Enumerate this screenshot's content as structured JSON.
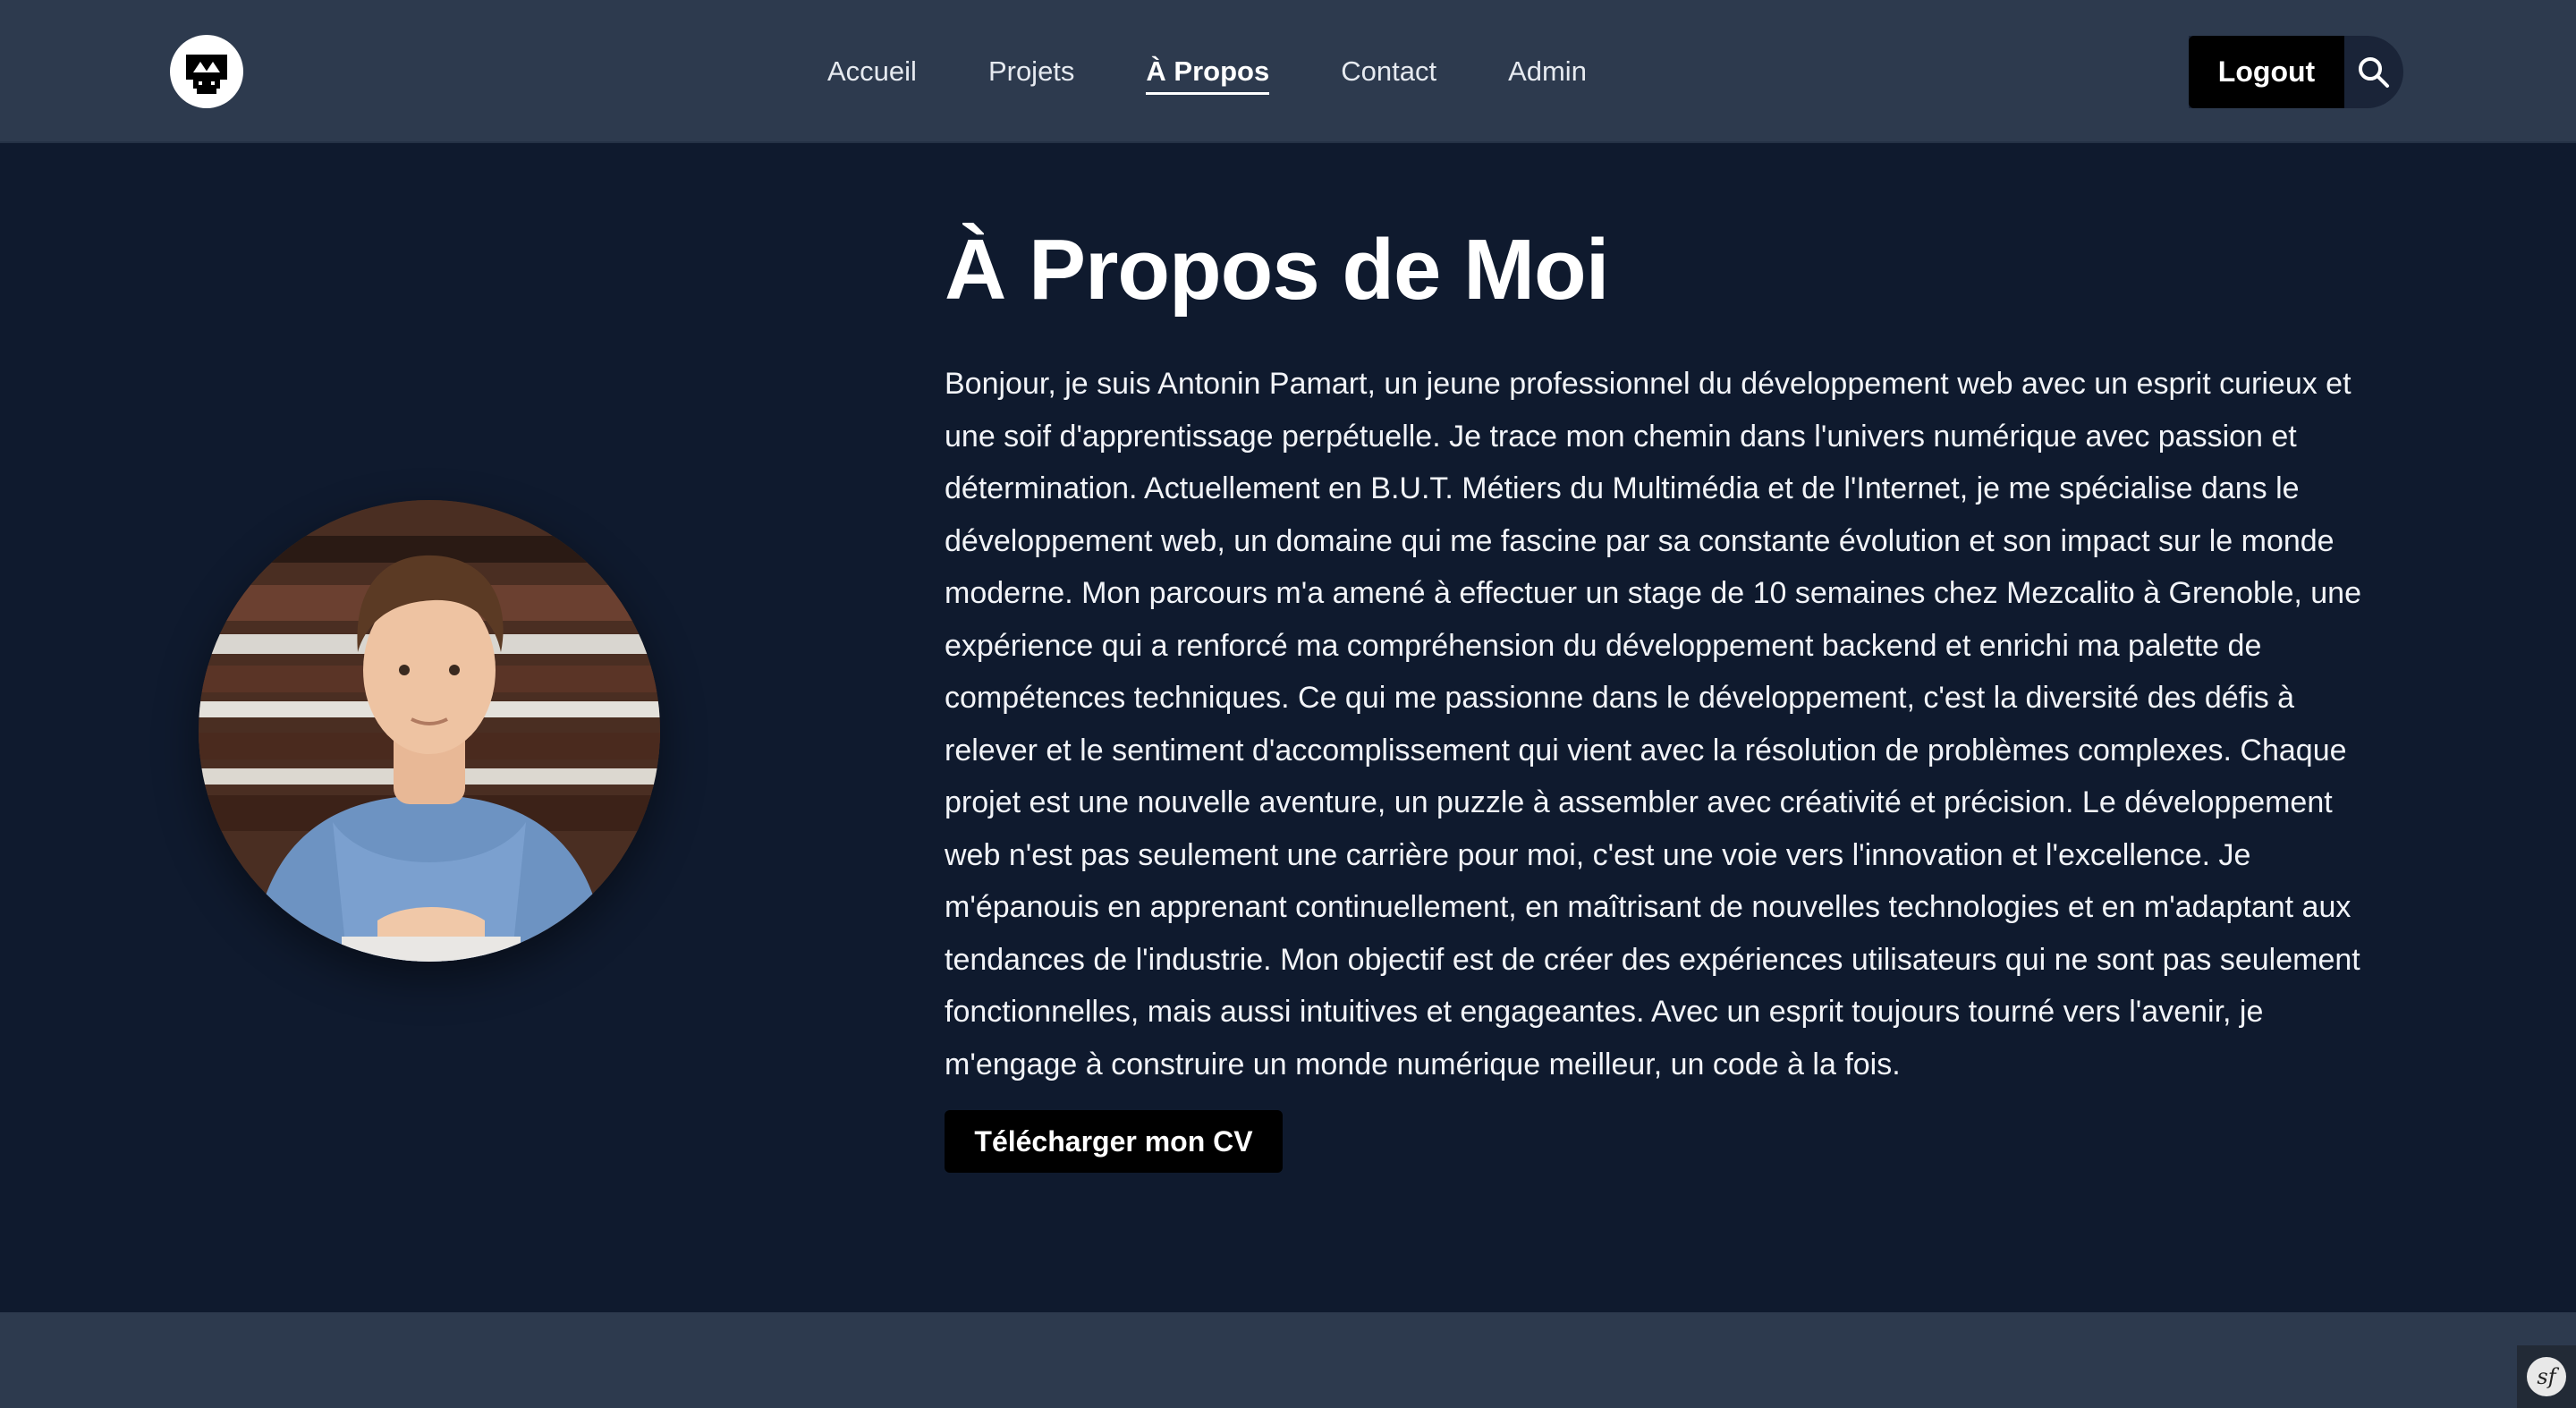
{
  "header": {
    "logo_icon": "pixel-face-logo-icon",
    "nav": [
      {
        "label": "Accueil",
        "active": false
      },
      {
        "label": "Projets",
        "active": false
      },
      {
        "label": "À Propos",
        "active": true
      },
      {
        "label": "Contact",
        "active": false
      },
      {
        "label": "Admin",
        "active": false
      }
    ],
    "logout_label": "Logout",
    "search_icon": "search-icon"
  },
  "main": {
    "title": "À Propos de Moi",
    "bio": "Bonjour, je suis Antonin Pamart, un jeune professionnel du développement web avec un esprit curieux et une soif d'apprentissage perpétuelle. Je trace mon chemin dans l'univers numérique avec passion et détermination. Actuellement en B.U.T. Métiers du Multimédia et de l'Internet, je me spécialise dans le développement web, un domaine qui me fascine par sa constante évolution et son impact sur le monde moderne. Mon parcours m'a amené à effectuer un stage de 10 semaines chez Mezcalito à Grenoble, une expérience qui a renforcé ma compréhension du développement backend et enrichi ma palette de compétences techniques. Ce qui me passionne dans le développement, c'est la diversité des défis à relever et le sentiment d'accomplissement qui vient avec la résolution de problèmes complexes. Chaque projet est une nouvelle aventure, un puzzle à assembler avec créativité et précision. Le développement web n'est pas seulement une carrière pour moi, c'est une voie vers l'innovation et l'excellence. Je m'épanouis en apprenant continuellement, en maîtrisant de nouvelles technologies et en m'adaptant aux tendances de l'industrie. Mon objectif est de créer des expériences utilisateurs qui ne sont pas seulement fonctionnelles, mais aussi intuitives et engageantes. Avec un esprit toujours tourné vers l'avenir, je m'engage à construire un monde numérique meilleur, un code à la fois.",
    "cv_button_label": "Télécharger mon CV",
    "avatar": "profile-photo"
  },
  "footer": {
    "debug_badge_icon": "symfony-icon"
  },
  "colors": {
    "header_bg": "#2d3a4e",
    "page_bg": "#0f1a2e",
    "button_bg": "#000000",
    "text": "#ffffff"
  }
}
